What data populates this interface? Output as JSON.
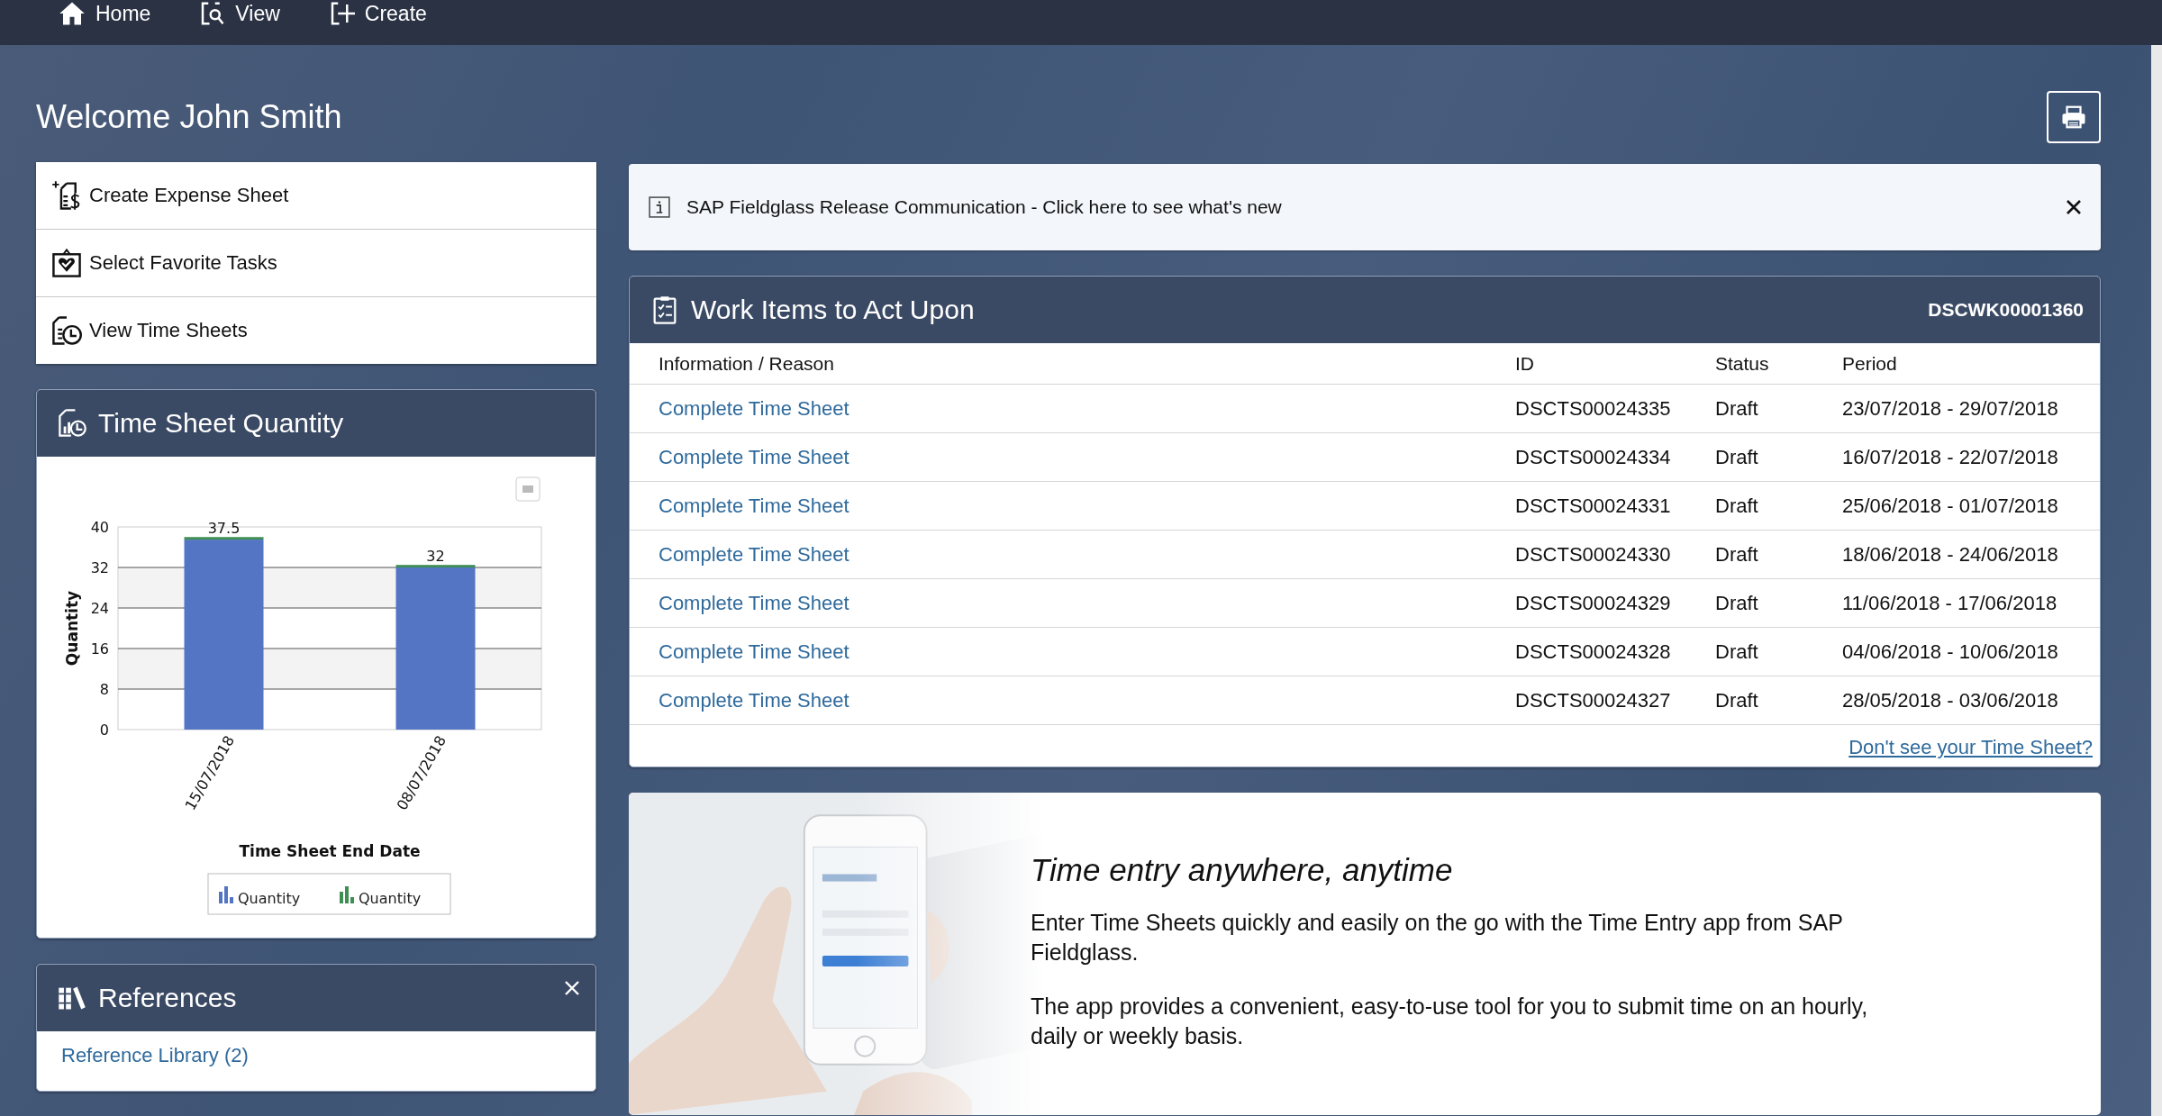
{
  "nav": [
    {
      "label": "Home",
      "kind": "home"
    },
    {
      "label": "View",
      "kind": "view"
    },
    {
      "label": "Create",
      "kind": "create"
    }
  ],
  "welcome": "Welcome John Smith",
  "quick_links": [
    {
      "label": "Create Expense Sheet",
      "kind": "expense"
    },
    {
      "label": "Select Favorite Tasks",
      "kind": "favorite"
    },
    {
      "label": "View Time Sheets",
      "kind": "timesheets"
    }
  ],
  "time_sheet_panel": {
    "title": "Time Sheet Quantity",
    "chart_data": {
      "type": "bar",
      "xlabel": "Time Sheet End Date",
      "ylabel": "Quantity",
      "categories": [
        "15/07/2018",
        "08/07/2018"
      ],
      "series": [
        {
          "name": "Quantity",
          "color": "#5475c4",
          "values": [
            37.5,
            32
          ]
        },
        {
          "name": "Quantity",
          "color": "#3f8f55",
          "values": [
            0.5,
            0.5
          ]
        }
      ],
      "ylim": [
        0,
        40
      ],
      "yticks": [
        0,
        8,
        16,
        24,
        32,
        40
      ],
      "stacked": true,
      "grid": true,
      "value_labels": [
        [
          "37.5",
          "32"
        ],
        [
          null,
          null
        ]
      ]
    }
  },
  "references": {
    "title": "References",
    "items": [
      "Reference Library (2)"
    ]
  },
  "banner": {
    "text": "SAP Fieldglass Release Communication - Click here to see what's new"
  },
  "work_items": {
    "title": "Work Items to Act Upon",
    "code": "DSCWK00001360",
    "columns": [
      "Information / Reason",
      "ID",
      "Status",
      "Period"
    ],
    "rows": [
      {
        "info": "Complete Time Sheet",
        "id": "DSCTS00024335",
        "status": "Draft",
        "period": "23/07/2018 - 29/07/2018"
      },
      {
        "info": "Complete Time Sheet",
        "id": "DSCTS00024334",
        "status": "Draft",
        "period": "16/07/2018 - 22/07/2018"
      },
      {
        "info": "Complete Time Sheet",
        "id": "DSCTS00024331",
        "status": "Draft",
        "period": "25/06/2018 - 01/07/2018"
      },
      {
        "info": "Complete Time Sheet",
        "id": "DSCTS00024330",
        "status": "Draft",
        "period": "18/06/2018 - 24/06/2018"
      },
      {
        "info": "Complete Time Sheet",
        "id": "DSCTS00024329",
        "status": "Draft",
        "period": "11/06/2018 - 17/06/2018"
      },
      {
        "info": "Complete Time Sheet",
        "id": "DSCTS00024328",
        "status": "Draft",
        "period": "04/06/2018 - 10/06/2018"
      },
      {
        "info": "Complete Time Sheet",
        "id": "DSCTS00024327",
        "status": "Draft",
        "period": "28/05/2018 - 03/06/2018"
      }
    ],
    "footer_link": "Don't see your Time Sheet?"
  },
  "promo": {
    "title": "Time entry anywhere, anytime",
    "paragraphs": [
      "Enter Time Sheets quickly and easily on the go with the Time Entry app from SAP Fieldglass.",
      "The app provides a convenient, easy-to-use tool for you to submit time on an hourly, daily or weekly basis."
    ]
  }
}
